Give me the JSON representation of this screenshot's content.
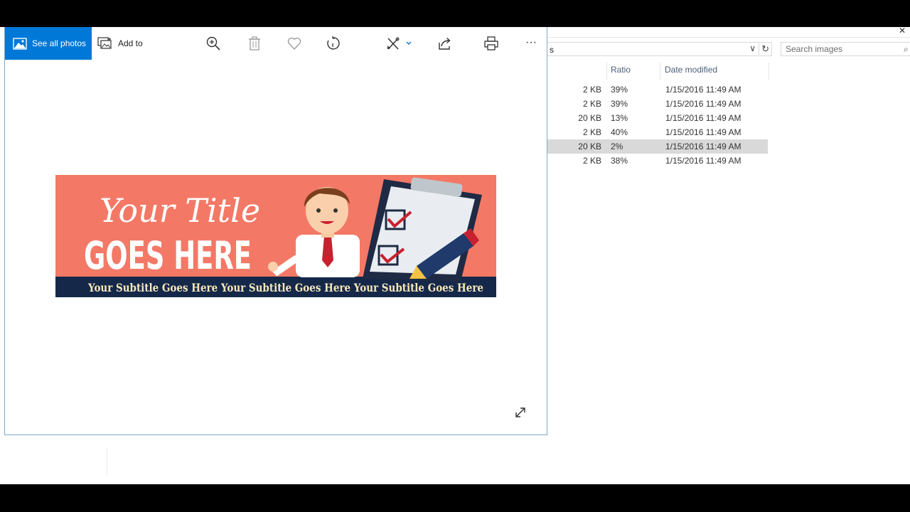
{
  "explorer": {
    "close_glyph": "✕",
    "address_text": "s",
    "search": {
      "placeholder": "Search images"
    },
    "columns": {
      "ratio": "Ratio",
      "date_modified": "Date modified"
    },
    "rows": [
      {
        "size": "2 KB",
        "ratio": "39%",
        "date": "1/15/2016 11:49 AM"
      },
      {
        "size": "2 KB",
        "ratio": "39%",
        "date": "1/15/2016 11:49 AM"
      },
      {
        "size": "20 KB",
        "ratio": "13%",
        "date": "1/15/2016 11:49 AM"
      },
      {
        "size": "2 KB",
        "ratio": "40%",
        "date": "1/15/2016 11:49 AM"
      },
      {
        "size": "20 KB",
        "ratio": "2%",
        "date": "1/15/2016 11:49 AM"
      },
      {
        "size": "2 KB",
        "ratio": "38%",
        "date": "1/15/2016 11:49 AM"
      }
    ]
  },
  "photos": {
    "toolbar": {
      "see_all_photos": "See all photos",
      "add_to": "Add to",
      "more": "···",
      "icons": [
        "zoom-in-icon",
        "delete-icon",
        "favorite-heart-icon",
        "rotate-icon",
        "edit-create-icon",
        "share-icon",
        "print-icon",
        "more-icon"
      ]
    },
    "banner": {
      "title_script": "Your Title",
      "title_bold": "GOES HERE",
      "subtitle": "Your Subtitle Goes Here Your Subtitle Goes Here Your Subtitle Goes Here"
    }
  },
  "colors": {
    "accent": "#0078d7",
    "banner_bg": "#f37866",
    "banner_strip": "#15284a",
    "subtitle_text": "#f6e7b8",
    "selected_row": "#d9d9d9",
    "column_header_text": "#4c607a"
  }
}
